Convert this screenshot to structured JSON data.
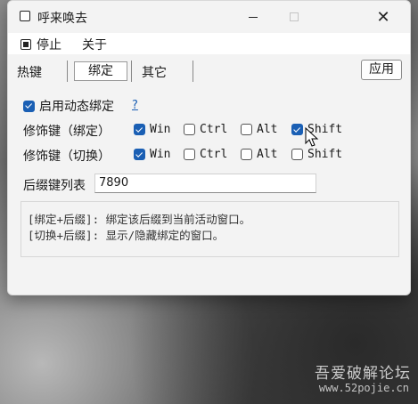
{
  "window": {
    "title": "呼来唤去"
  },
  "menu": {
    "stop": "停止",
    "about": "关于"
  },
  "tabs": {
    "hotkey": "热键",
    "bind": "绑定",
    "other": "其它"
  },
  "apply_label": "应用",
  "dynamic_bind": {
    "label": "启用动态绑定",
    "checked": true,
    "help": "?"
  },
  "modifier_bind": {
    "label": "修饰键（绑定）",
    "keys": [
      {
        "name": "Win",
        "checked": true
      },
      {
        "name": "Ctrl",
        "checked": false
      },
      {
        "name": "Alt",
        "checked": false
      },
      {
        "name": "Shift",
        "checked": true
      }
    ]
  },
  "modifier_switch": {
    "label": "修饰键（切换）",
    "keys": [
      {
        "name": "Win",
        "checked": true
      },
      {
        "name": "Ctrl",
        "checked": false
      },
      {
        "name": "Alt",
        "checked": false
      },
      {
        "name": "Shift",
        "checked": false
      }
    ]
  },
  "suffix": {
    "label": "后缀键列表",
    "value": "7890"
  },
  "info": {
    "line1": "[绑定+后缀]: 绑定该后缀到当前活动窗口。",
    "line2": "[切换+后缀]: 显示/隐藏绑定的窗口。"
  },
  "watermark": {
    "text": "吾爱破解论坛",
    "url": "www.52pojie.cn"
  },
  "colors": {
    "accent": "#1a5fb4",
    "window_bg": "#f3f3f3"
  }
}
